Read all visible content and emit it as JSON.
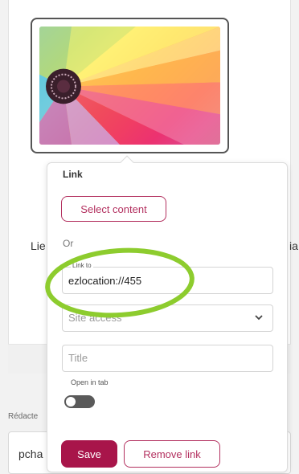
{
  "background": {
    "left_label": "Lie",
    "right_label": "ia",
    "editor_label": "Rédacte",
    "editor_input": "pcha"
  },
  "popover": {
    "title": "Link",
    "select_content_label": "Select content",
    "or_label": "Or",
    "link_to_label": "Link to",
    "link_to_value": "ezlocation://455",
    "site_access_placeholder": "Site access",
    "title_placeholder": "Title",
    "open_in_tab_label": "Open in tab",
    "open_in_tab_enabled": false,
    "save_label": "Save",
    "remove_link_label": "Remove link"
  },
  "colors": {
    "accent": "#a8154a",
    "highlight": "#8dcc2e"
  },
  "icons": {
    "dropdown": "chevron-down-icon"
  }
}
